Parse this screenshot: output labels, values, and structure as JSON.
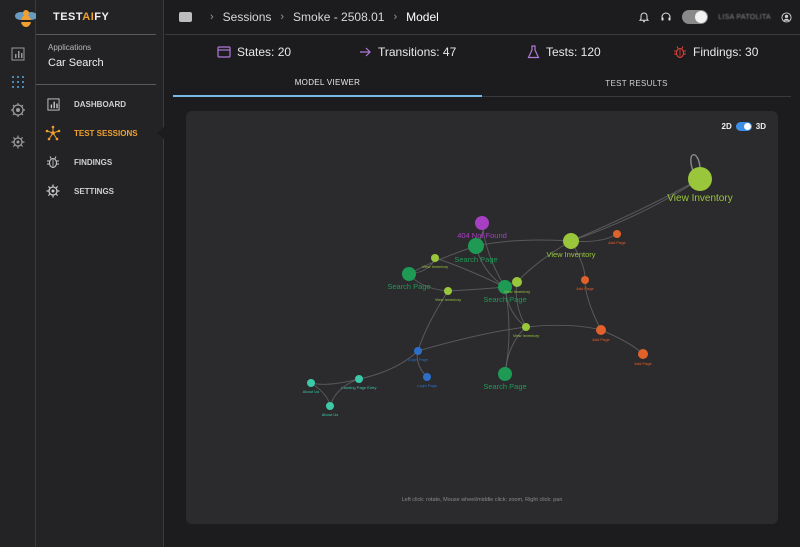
{
  "brand": {
    "prefix": "TEST",
    "accent": "AI",
    "suffix": "FY"
  },
  "sidebar": {
    "app_label": "Applications",
    "app_name": "Car Search",
    "items": [
      {
        "label": "DASHBOARD",
        "icon": "bar-chart-icon"
      },
      {
        "label": "TEST SESSIONS",
        "icon": "network-icon",
        "active": true
      },
      {
        "label": "FINDINGS",
        "icon": "bug-icon"
      },
      {
        "label": "SETTINGS",
        "icon": "gear-icon"
      }
    ]
  },
  "breadcrumb": [
    "Sessions",
    "Smoke - 2508.01",
    "Model"
  ],
  "header": {
    "user": "LISA PATOLITA"
  },
  "stats": {
    "states": "States: 20",
    "transitions": "Transitions: 47",
    "tests": "Tests: 120",
    "findings": "Findings: 30"
  },
  "tabs": {
    "model_viewer": "MODEL VIEWER",
    "test_results": "TEST RESULTS"
  },
  "viewer": {
    "toggle_2d": "2D",
    "toggle_3d": "3D",
    "hint": "Left click: rotate, Mouse wheel/middle click: zoom, Right click: pan"
  },
  "graph": {
    "colors": {
      "inventory": "#9ac63c",
      "search": "#1f9a55",
      "add": "#e0612a",
      "notfound": "#a63fc2",
      "blue": "#2c6fc8",
      "teal": "#3cc9a8"
    },
    "nodes": [
      {
        "label": "View Inventory",
        "type": "inventory",
        "big": true
      },
      {
        "label": "404 Not Found",
        "type": "notfound"
      },
      {
        "label": "Search Page",
        "type": "search"
      },
      {
        "label": "View Inventory",
        "type": "inventory"
      },
      {
        "label": "Add Page",
        "type": "add"
      },
      {
        "label": "View Inventory",
        "type": "inventory"
      },
      {
        "label": "Search Page",
        "type": "search"
      },
      {
        "label": "View Inventory",
        "type": "inventory"
      },
      {
        "label": "Search Page",
        "type": "search"
      },
      {
        "label": "View Inventory",
        "type": "inventory"
      },
      {
        "label": "Add Page",
        "type": "add"
      },
      {
        "label": "View Inventory",
        "type": "inventory"
      },
      {
        "label": "Add Page",
        "type": "add"
      },
      {
        "label": "Add Page",
        "type": "add"
      },
      {
        "label": "Search Page",
        "type": "search"
      },
      {
        "label": "Login Page",
        "type": "blue"
      },
      {
        "label": "Login Page",
        "type": "blue"
      },
      {
        "label": "Landing Page Entry",
        "type": "teal"
      },
      {
        "label": "About Us",
        "type": "teal"
      },
      {
        "label": "About Us",
        "type": "teal"
      }
    ]
  }
}
